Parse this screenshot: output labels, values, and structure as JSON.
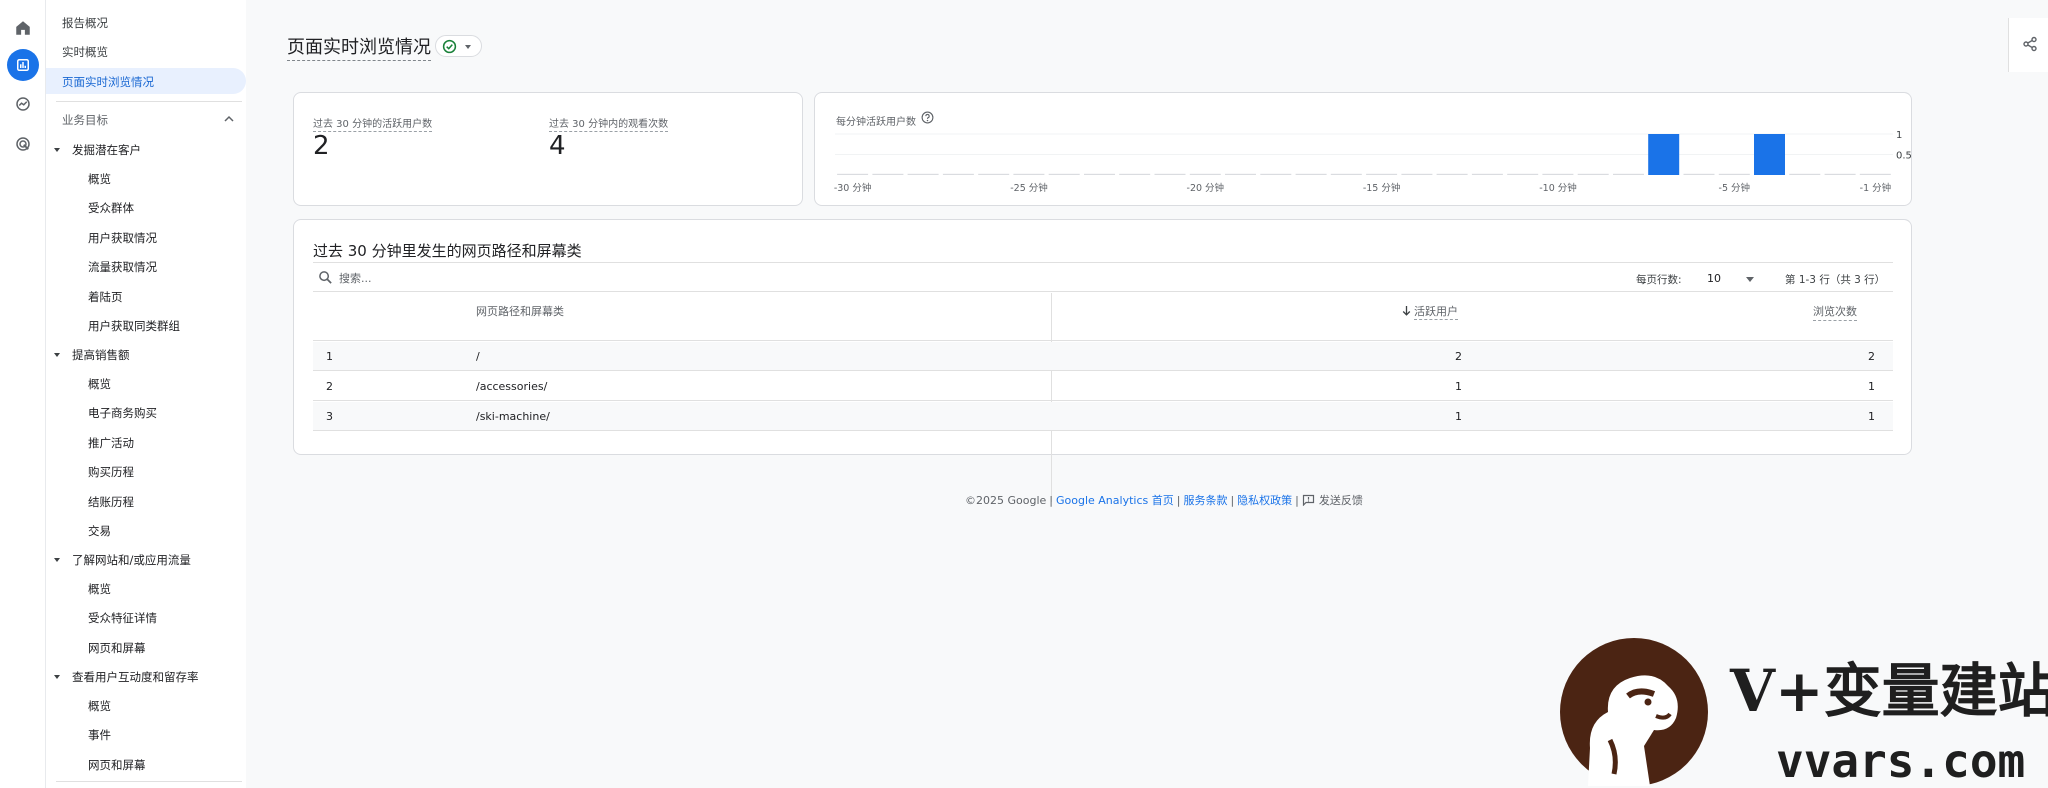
{
  "sidebar": {
    "top_items": [
      {
        "label": "报告概况"
      },
      {
        "label": "实时概览"
      },
      {
        "label": "页面实时浏览情况",
        "active": true
      }
    ],
    "section_label": "业务目标",
    "groups": [
      {
        "label": "发掘潜在客户",
        "items": [
          "概览",
          "受众群体",
          "用户获取情况",
          "流量获取情况",
          "着陆页",
          "用户获取同类群组"
        ]
      },
      {
        "label": "提高销售额",
        "items": [
          "概览",
          "电子商务购买",
          "推广活动",
          "购买历程",
          "结账历程",
          "交易"
        ]
      },
      {
        "label": "了解网站和/或应用流量",
        "items": [
          "概览",
          "受众特征详情",
          "网页和屏幕"
        ]
      },
      {
        "label": "查看用户互动度和留存率",
        "items": [
          "概览",
          "事件",
          "网页和屏幕"
        ]
      }
    ]
  },
  "header": {
    "title": "页面实时浏览情况"
  },
  "metrics": {
    "users_label": "过去 30 分钟的活跃用户数",
    "users_value": "2",
    "views_label": "过去 30 分钟内的观看次数",
    "views_value": "4"
  },
  "chart_data": {
    "type": "bar",
    "title": "每分钟活跃用户数",
    "x_tick_labels": [
      "-30 分钟",
      "-25 分钟",
      "-20 分钟",
      "-15 分钟",
      "-10 分钟",
      "-5 分钟",
      "-1 分钟"
    ],
    "x": [
      -30,
      -29,
      -28,
      -27,
      -26,
      -25,
      -24,
      -23,
      -22,
      -21,
      -20,
      -19,
      -18,
      -17,
      -16,
      -15,
      -14,
      -13,
      -12,
      -11,
      -10,
      -9,
      -8,
      -7,
      -6,
      -5,
      -4,
      -3,
      -2,
      -1
    ],
    "values": [
      0,
      0,
      0,
      0,
      0,
      0,
      0,
      0,
      0,
      0,
      0,
      0,
      0,
      0,
      0,
      0,
      0,
      0,
      0,
      0,
      0,
      0,
      0,
      1,
      0,
      0,
      1,
      0,
      0,
      0
    ],
    "y_tick_labels": [
      "1",
      "0.5"
    ],
    "ylim": [
      0,
      1
    ],
    "bar_color": "#1a73e8"
  },
  "table": {
    "title": "过去 30 分钟里发生的网页路径和屏幕类",
    "search_placeholder": "搜索...",
    "rows_per_page_label": "每页行数:",
    "rows_per_page_value": "10",
    "pagination": "第 1-3 行（共 3 行）",
    "columns": {
      "path": "网页路径和屏幕类",
      "active_users": "活跃用户",
      "views": "浏览次数"
    },
    "rows": [
      {
        "index": "1",
        "path": "/",
        "active_users": "2",
        "views": "2"
      },
      {
        "index": "2",
        "path": "/accessories/",
        "active_users": "1",
        "views": "1"
      },
      {
        "index": "3",
        "path": "/ski-machine/",
        "active_users": "1",
        "views": "1"
      }
    ]
  },
  "footer": {
    "copyright": "©2025 Google",
    "link_home": "Google Analytics 首页",
    "link_terms": "服务条款",
    "link_privacy": "隐私权政策",
    "feedback": "发送反馈"
  },
  "watermark": {
    "brand": "V+变量建站",
    "domain": "vvars.com"
  },
  "colors": {
    "accent": "#1a73e8",
    "active_nav_bg": "#e8f0fe",
    "success": "#188038"
  }
}
